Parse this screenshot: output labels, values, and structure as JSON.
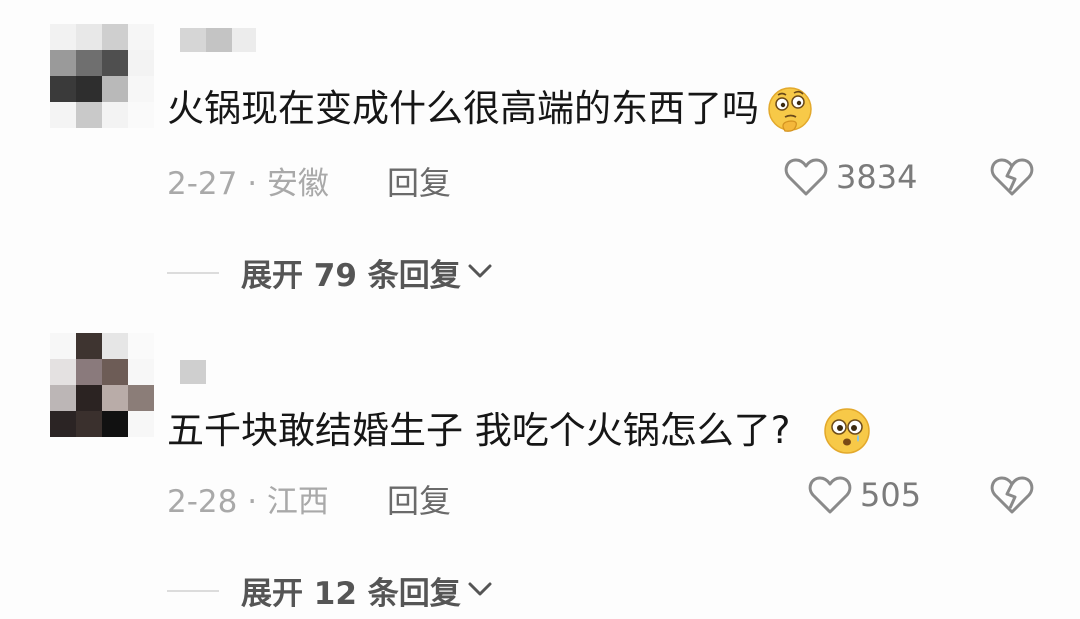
{
  "comments": [
    {
      "text": "火锅现在变成什么很高端的东西了吗",
      "emoji": "thinking-face-emoji",
      "date_location": "2-27 · 安徽",
      "reply_label": "回复",
      "likes": "3834",
      "expand_label": "展开 79 条回复"
    },
    {
      "text": "五千块敢结婚生子 我吃个火锅怎么了?",
      "emoji": "crying-face-emoji",
      "date_location": "2-28 · 江西",
      "reply_label": "回复",
      "likes": "505",
      "expand_label": "展开 12 条回复"
    }
  ],
  "colors": {
    "text": "#161616",
    "meta": "#a9a9a9",
    "reply": "#6a6a6a",
    "emoji_yellow": "#f7c948"
  }
}
